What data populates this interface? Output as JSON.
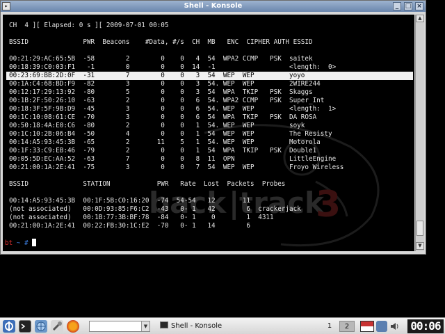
{
  "window": {
    "title": "Shell - Konsole",
    "icon": "konsole-icon",
    "controls": [
      "minimize-icon",
      "maximize-icon",
      "close-icon"
    ]
  },
  "terminal": {
    "status_line": "CH  4 ][ Elapsed: 0 s ][ 2009-07-01 00:05",
    "ap_header": "BSSID              PWR  Beacons    #Data, #/s  CH  MB   ENC  CIPHER AUTH ESSID",
    "ap_rows": [
      "00:21:29:AC:65:5B  -58        2        0    0   4  54  WPA2 CCMP   PSK  saitek",
      "00:18:39:C0:03:F1   -1        0        0    0  14  -1                   <length:  0>",
      "00:23:69:BB:2D:0F  -31        7        0    0   3  54  WEP  WEP         yoyo",
      "00:1A:C4:68:BD:F9  -82        3        0    0   3  54. WEP  WEP         2WIRE244",
      "00:12:17:29:13:92  -80        5        0    0   3  54  WPA  TKIP   PSK  Skaggs",
      "00:1B:2F:50:26:10  -63        2        0    0   6  54. WPA2 CCMP   PSK  Super_Int",
      "00:18:3F:5F:9B:D9  -45        3        0    0   6  54. WEP  WEP         <length:  1>",
      "00:1C:10:08:61:CE  -70        3        0    0   6  54  WPA  TKIP   PSK  DA ROSA",
      "00:50:18:4A:E0:C6  -80        2        0    0   1  54. WEP  WEP         soyk",
      "00:1C:10:2B:06:B4  -50        4        0    0   1  54  WEP  WEP         The Resisty",
      "00:14:A5:93:45:3B  -65        2       11    5   1  54. WEP  WEP         Motorola",
      "00:1F:33:C9:EB:46  -79        2        0    0   1  54  WPA  TKIP   PSK  Double1",
      "00:05:5D:EC:AA:52  -63        7        0    0   8  11  OPN              LittleEngine",
      "00:21:00:1A:2E:41  -75        3        0    0   7  54  WEP  WEP         Froyo Wireless"
    ],
    "highlighted_row": 2,
    "station_header": "BSSID              STATION            PWR   Rate  Lost  Packets  Probes",
    "station_rows": [
      "00:14:A5:93:45:3B  00:1F:5B:C0:16:20  -74  54-54   12       11",
      "(not associated)   00:0D:93:85:F6:C2  -43   0- 1   42        6  crackerjack",
      "(not associated)   00:1B:77:3B:BF:78  -84   0- 1    0        1  4311",
      "00:21:00:1A:2E:41  00:22:FB:30:1C:E2  -70   0- 1   14        6"
    ],
    "prompt_user": "bt",
    "prompt_sep": " ~ ",
    "prompt_symbol": "#"
  },
  "taskbar": {
    "task_label": "Shell - Konsole",
    "desktops": [
      "1",
      "2"
    ],
    "active_desktop": 1,
    "clock": "00:06",
    "launcher_icons": [
      "kde-menu-icon",
      "terminal-icon",
      "network-icon",
      "tools-icon",
      "firefox-icon"
    ],
    "tray_icons": [
      "keyboard-layout-icon",
      "network-tray-icon",
      "volume-icon"
    ]
  },
  "colors": {
    "title_gradient_top": "#9db3cf",
    "title_gradient_bottom": "#6a86ad",
    "terminal_bg": "#000000",
    "terminal_fg": "#e6e6e6",
    "prompt_user": "#e03030",
    "prompt_symbol": "#3a7ad8"
  }
}
